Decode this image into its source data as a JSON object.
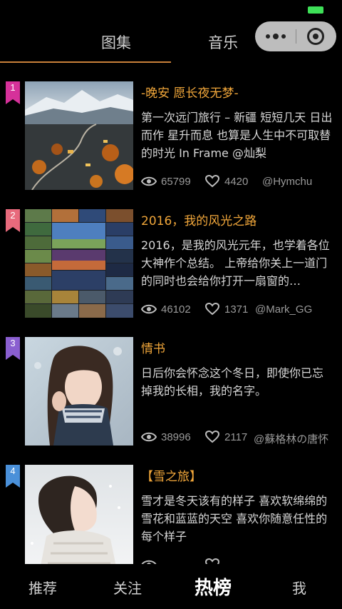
{
  "top_tabs": [
    {
      "label": "图集",
      "active": true
    },
    {
      "label": "音乐",
      "active": false
    }
  ],
  "accent_color": "#c9803a",
  "title_color": "#f0a63a",
  "items": [
    {
      "rank": "1",
      "rank_color": "#d6319a",
      "title": "-晚安 愿长夜无梦-",
      "description": "第一次远门旅行 – 新疆 短短几天 日出而作 星升而息 也算是人生中不可取替的时光 In Frame @灿梨",
      "views": "65799",
      "likes": "4420",
      "author": "@Hymchu"
    },
    {
      "rank": "2",
      "rank_color": "#e86a7c",
      "title": "2016，我的风光之路",
      "description": "2016，是我的风光元年，也学着各位大神作个总结。 上帝给你关上一道门的同时也会给你打开一扇窗的…",
      "views": "46102",
      "likes": "1371",
      "author": "@Mark_GG"
    },
    {
      "rank": "3",
      "rank_color": "#8a5fd0",
      "title": "情书",
      "description": "日后你会怀念这个冬日，即使你已忘掉我的长相，我的名字。",
      "views": "38996",
      "likes": "2117",
      "author": "@蘇格林の唐怀"
    },
    {
      "rank": "4",
      "rank_color": "#4a90d9",
      "title": "【雪之旅】",
      "description": "雪才是冬天该有的样子 喜欢软绵绵的雪花和蓝蓝的天空 喜欢你随意任性的每个样子",
      "views": "",
      "likes": "",
      "author": ""
    }
  ],
  "bottom_nav": [
    {
      "label": "推荐",
      "active": false
    },
    {
      "label": "关注",
      "active": false
    },
    {
      "label": "热榜",
      "active": true
    },
    {
      "label": "我",
      "active": false
    }
  ]
}
